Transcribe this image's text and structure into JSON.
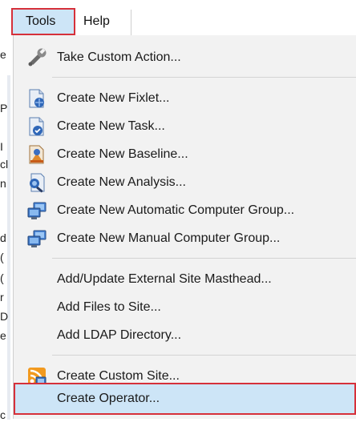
{
  "menubar": {
    "tools_label": "Tools",
    "help_label": "Help"
  },
  "background_fragments": [
    "e",
    "P",
    "I",
    "cl",
    "n",
    "d",
    "(",
    "(",
    "r",
    "D",
    "e",
    "c"
  ],
  "menu": {
    "items": [
      {
        "label": "Take Custom Action...",
        "icon": "wrench-icon"
      },
      {
        "label": "Create New Fixlet...",
        "icon": "fixlet-icon"
      },
      {
        "label": "Create New Task...",
        "icon": "task-icon"
      },
      {
        "label": "Create New Baseline...",
        "icon": "baseline-icon"
      },
      {
        "label": "Create New Analysis...",
        "icon": "analysis-icon"
      },
      {
        "label": "Create New Automatic Computer Group...",
        "icon": "computer-group-icon"
      },
      {
        "label": "Create New Manual Computer Group...",
        "icon": "computer-group-icon"
      },
      {
        "label": "Add/Update External Site Masthead...",
        "icon": ""
      },
      {
        "label": "Add Files to Site...",
        "icon": ""
      },
      {
        "label": "Add LDAP Directory...",
        "icon": ""
      },
      {
        "label": "Create Custom Site...",
        "icon": "custom-site-icon"
      },
      {
        "label": "Create Operator...",
        "icon": "",
        "selected": true
      }
    ]
  },
  "colors": {
    "highlight": "#cde5f7",
    "selection_border": "#d6303a",
    "menu_background": "#f2f2f2"
  }
}
